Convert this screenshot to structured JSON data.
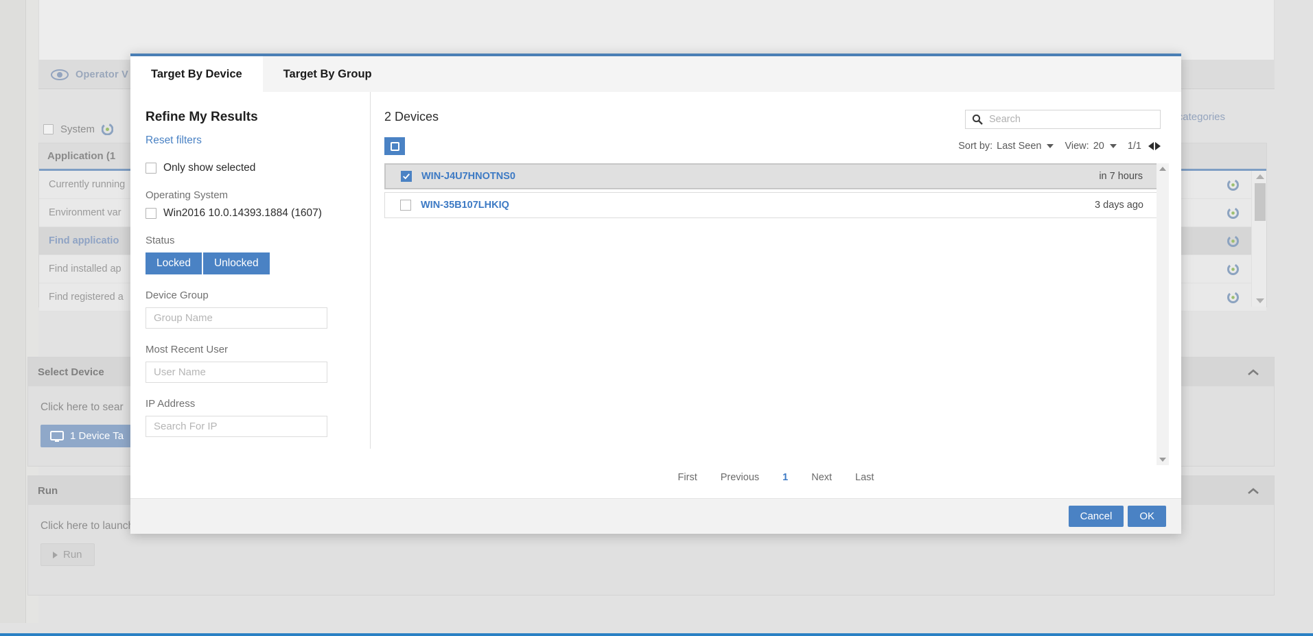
{
  "background": {
    "operator_tab": "Operator V",
    "system_checkbox_label": "System",
    "filter_categories_label": "Filter categories",
    "category_header": "Application (1",
    "category_rows": [
      "Currently running",
      "Environment var",
      "Find applicatio",
      "Find installed ap",
      "Find registered a"
    ],
    "sections": [
      {
        "title": "Select Device",
        "hint": "Click here to sear",
        "button_label": "1 Device Ta"
      },
      {
        "title": "Run",
        "hint": "Click here to launch the query on the target selected.",
        "button_label": "Run"
      }
    ]
  },
  "modal": {
    "tabs": [
      {
        "label": "Target By Device",
        "active": true
      },
      {
        "label": "Target By Group",
        "active": false
      }
    ],
    "refine": {
      "title": "Refine My Results",
      "reset_label": "Reset filters",
      "only_show_selected_label": "Only show selected",
      "operating_system_label": "Operating System",
      "operating_system_option": "Win2016 10.0.14393.1884 (1607)",
      "status_label": "Status",
      "status_options": [
        "Locked",
        "Unlocked"
      ],
      "device_group_label": "Device Group",
      "device_group_placeholder": "Group Name",
      "device_group_value": "",
      "most_recent_user_label": "Most Recent User",
      "most_recent_user_placeholder": "User Name",
      "most_recent_user_value": "",
      "ip_address_label": "IP Address",
      "ip_address_placeholder": "Search For IP",
      "ip_address_value": ""
    },
    "results": {
      "count_label": "2 Devices",
      "search_placeholder": "Search",
      "search_value": "",
      "sort_prefix": "Sort by:",
      "sort_value": "Last Seen",
      "view_prefix": "View:",
      "view_value": "20",
      "page_indicator": "1/1",
      "devices": [
        {
          "name": "WIN-J4U7HNOTNS0",
          "last_seen": "in 7 hours",
          "checked": true,
          "selected": true
        },
        {
          "name": "WIN-35B107LHKIQ",
          "last_seen": "3 days ago",
          "checked": false,
          "selected": false
        }
      ],
      "pager": {
        "first": "First",
        "previous": "Previous",
        "current": "1",
        "next": "Next",
        "last": "Last"
      }
    },
    "footer": {
      "cancel_label": "Cancel",
      "ok_label": "OK"
    }
  },
  "colors": {
    "accent_blue": "#4a82c4",
    "link_blue": "#3d7ac4",
    "modal_top_border": "#4a7fb5",
    "bottom_bar": "#2980c4"
  }
}
